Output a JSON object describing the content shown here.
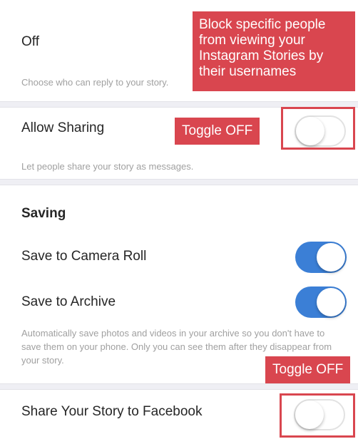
{
  "reply_section": {
    "value_label": "Off",
    "description": "Choose who can reply to your story."
  },
  "sharing_section": {
    "allow_sharing_label": "Allow Sharing",
    "allow_sharing_state": "off",
    "allow_sharing_description": "Let people share your story as messages."
  },
  "saving_section": {
    "heading": "Saving",
    "save_camera_roll_label": "Save to Camera Roll",
    "save_camera_roll_state": "on",
    "save_archive_label": "Save to Archive",
    "save_archive_state": "on",
    "description": "Automatically save photos and videos in your archive so you don't have to save them on your phone. Only you can see them after they disappear from your story."
  },
  "facebook_section": {
    "share_facebook_label": "Share Your Story to Facebook",
    "share_facebook_state": "off"
  },
  "annotations": {
    "block_callout": "Block specific people from viewing your Instagram Stories by their usernames",
    "toggle_off_label_1": "Toggle OFF",
    "toggle_off_label_2": "Toggle OFF"
  },
  "colors": {
    "toggle_on": "#3b7fd6",
    "callout_red": "#d9464f",
    "separator": "#efeff4"
  }
}
